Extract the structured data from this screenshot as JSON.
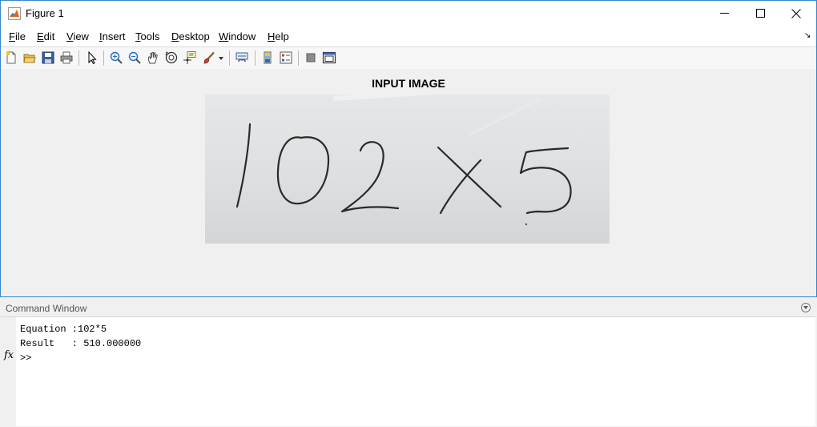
{
  "window": {
    "title": "Figure 1"
  },
  "menubar": {
    "items": [
      "File",
      "Edit",
      "View",
      "Insert",
      "Tools",
      "Desktop",
      "Window",
      "Help"
    ]
  },
  "toolbar": {
    "icons": [
      "new-figure-icon",
      "open-file-icon",
      "save-icon",
      "print-icon",
      "edit-plot-icon",
      "zoom-in-icon",
      "zoom-out-icon",
      "pan-icon",
      "rotate-3d-icon",
      "data-cursor-icon",
      "brush-icon",
      "link-plot-icon",
      "insert-colorbar-icon",
      "insert-legend-icon",
      "hide-plot-tools-icon",
      "show-plot-tools-icon"
    ]
  },
  "figure": {
    "axes_title": "INPUT IMAGE",
    "image": {
      "handwritten_expression": "102X5"
    }
  },
  "command_window": {
    "title": "Command Window",
    "lines": [
      "Equation :102*5",
      "Result   : 510.000000"
    ],
    "prompt": ">>"
  }
}
